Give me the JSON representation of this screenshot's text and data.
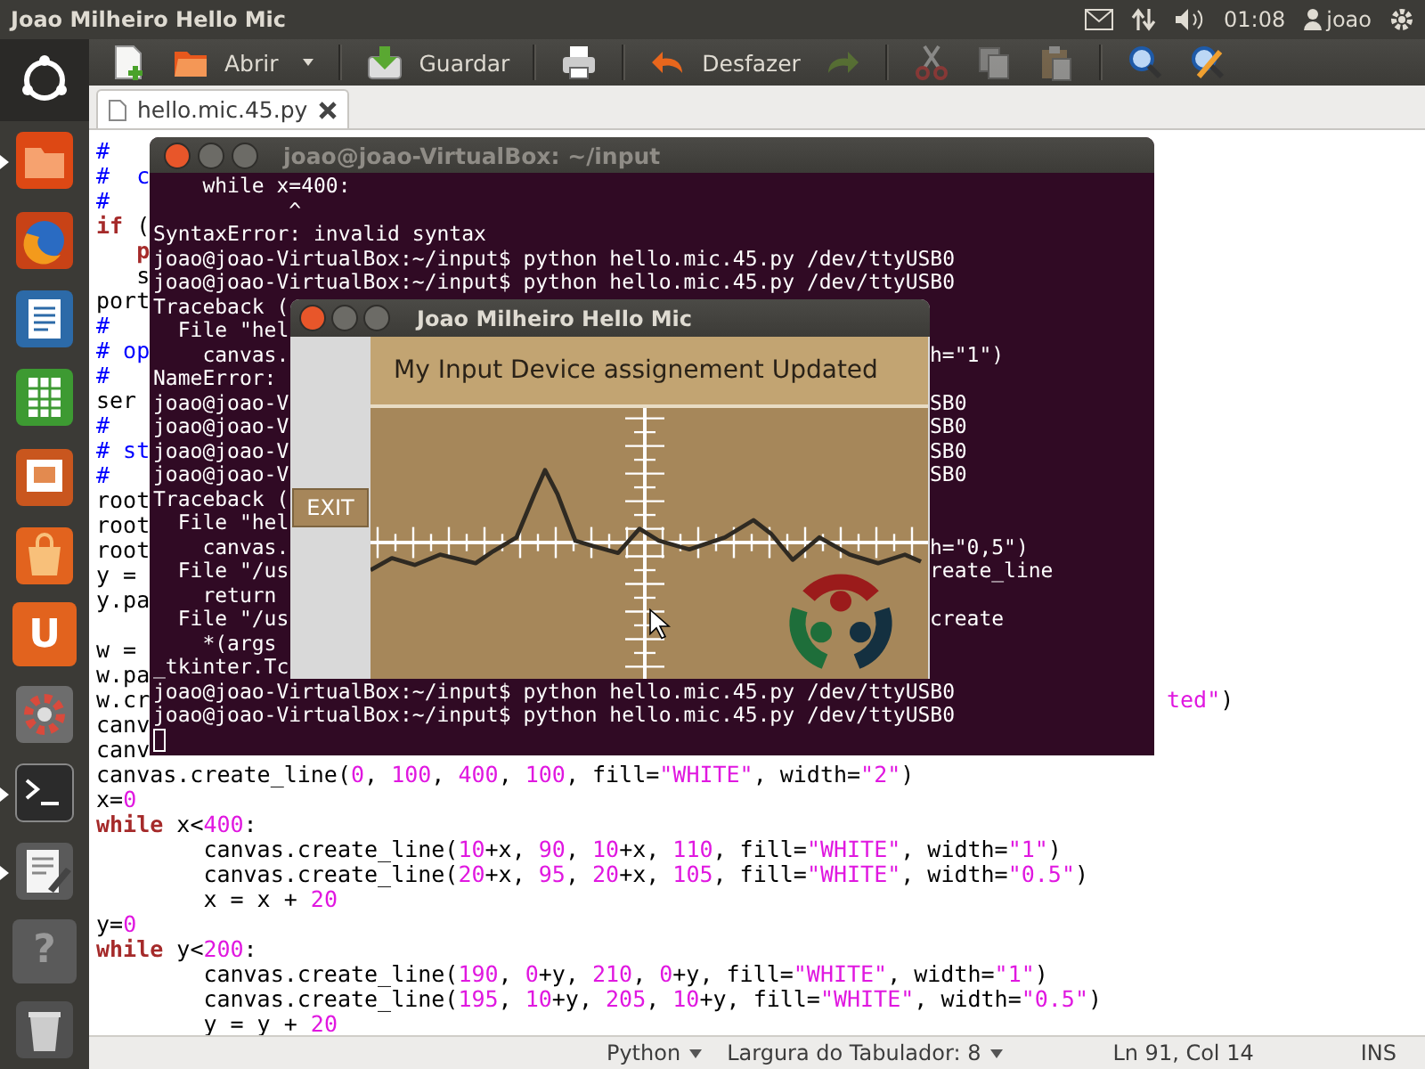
{
  "top_panel": {
    "title": "Joao Milheiro Hello Mic",
    "clock": "01:08",
    "user": "joao"
  },
  "launcher": [
    {
      "kind": "home",
      "running": false
    },
    {
      "kind": "files",
      "running": true
    },
    {
      "kind": "browser",
      "running": false
    },
    {
      "kind": "writer",
      "running": false
    },
    {
      "kind": "calc",
      "running": false
    },
    {
      "kind": "impress",
      "running": false
    },
    {
      "kind": "store",
      "running": false
    },
    {
      "kind": "ubuntu-one",
      "label": "U",
      "running": false
    },
    {
      "kind": "settings",
      "running": false
    },
    {
      "kind": "terminal",
      "running": true
    },
    {
      "kind": "editor",
      "running": true
    },
    {
      "kind": "help",
      "label": "?",
      "running": false
    },
    {
      "kind": "trash",
      "running": false
    }
  ],
  "toolbar": [
    {
      "kind": "new",
      "disabled": false
    },
    {
      "kind": "open",
      "label": "Abrir",
      "disabled": false
    },
    {
      "kind": "open-menu",
      "disabled": false
    },
    {
      "kind": "separator"
    },
    {
      "kind": "save",
      "label": "Guardar",
      "disabled": false
    },
    {
      "kind": "separator"
    },
    {
      "kind": "print",
      "disabled": false
    },
    {
      "kind": "separator"
    },
    {
      "kind": "undo",
      "label": "Desfazer",
      "disabled": false
    },
    {
      "kind": "redo",
      "disabled": true
    },
    {
      "kind": "separator"
    },
    {
      "kind": "cut",
      "disabled": true
    },
    {
      "kind": "copy",
      "disabled": true
    },
    {
      "kind": "paste",
      "disabled": true
    },
    {
      "kind": "separator"
    },
    {
      "kind": "find",
      "disabled": false
    },
    {
      "kind": "replace",
      "disabled": false
    }
  ],
  "tabs": [
    {
      "label": "hello.mic.45.py",
      "selected": true
    }
  ],
  "editor": {
    "lines": [
      {
        "kind": "code",
        "tokens": [
          {
            "kind": "comment",
            "text": "#"
          }
        ]
      },
      {
        "kind": "code",
        "tokens": [
          {
            "kind": "comment",
            "text": "#  c"
          }
        ]
      },
      {
        "kind": "code",
        "tokens": [
          {
            "kind": "comment",
            "text": "#"
          }
        ]
      },
      {
        "kind": "code",
        "tokens": [
          {
            "kind": "kw",
            "text": "if"
          },
          {
            "kind": "plain",
            "text": " ("
          }
        ]
      },
      {
        "kind": "code",
        "tokens": [
          {
            "kind": "kw",
            "text": "   p"
          }
        ]
      },
      {
        "kind": "code",
        "tokens": [
          {
            "kind": "plain",
            "text": "   s"
          }
        ]
      },
      {
        "kind": "code",
        "tokens": [
          {
            "kind": "plain",
            "text": "port"
          }
        ]
      },
      {
        "kind": "code",
        "tokens": [
          {
            "kind": "comment",
            "text": "#"
          }
        ]
      },
      {
        "kind": "code",
        "tokens": [
          {
            "kind": "comment",
            "text": "# op"
          }
        ]
      },
      {
        "kind": "code",
        "tokens": [
          {
            "kind": "comment",
            "text": "#"
          }
        ]
      },
      {
        "kind": "code",
        "tokens": [
          {
            "kind": "plain",
            "text": "ser"
          }
        ]
      },
      {
        "kind": "code",
        "tokens": [
          {
            "kind": "comment",
            "text": "#"
          }
        ]
      },
      {
        "kind": "code",
        "tokens": [
          {
            "kind": "comment",
            "text": "# st"
          }
        ]
      },
      {
        "kind": "code",
        "tokens": [
          {
            "kind": "comment",
            "text": "#"
          }
        ]
      },
      {
        "kind": "code",
        "tokens": [
          {
            "kind": "plain",
            "text": "root"
          }
        ]
      },
      {
        "kind": "code",
        "tokens": [
          {
            "kind": "plain",
            "text": "root"
          }
        ]
      },
      {
        "kind": "code",
        "tokens": [
          {
            "kind": "plain",
            "text": "root"
          }
        ]
      },
      {
        "kind": "code",
        "tokens": [
          {
            "kind": "plain",
            "text": "y ="
          }
        ]
      },
      {
        "kind": "code",
        "tokens": [
          {
            "kind": "plain",
            "text": "y.pa"
          }
        ]
      },
      {
        "kind": "blank"
      },
      {
        "kind": "code",
        "tokens": [
          {
            "kind": "plain",
            "text": "w ="
          }
        ]
      },
      {
        "kind": "code",
        "tokens": [
          {
            "kind": "plain",
            "text": "w.pa"
          }
        ]
      },
      {
        "kind": "code",
        "tokens": [
          {
            "kind": "plain",
            "text": "w.cr"
          }
        ],
        "right_tokens": [
          {
            "kind": "str",
            "text": "ted\""
          },
          {
            "kind": "plain",
            "text": ")"
          }
        ]
      },
      {
        "kind": "code",
        "tokens": [
          {
            "kind": "plain",
            "text": "canv"
          }
        ]
      },
      {
        "kind": "code",
        "tokens": [
          {
            "kind": "plain",
            "text": "canv"
          }
        ]
      },
      {
        "kind": "code",
        "tokens": [
          {
            "kind": "plain",
            "text": "canvas.create_line("
          },
          {
            "kind": "num",
            "text": "0"
          },
          {
            "kind": "plain",
            "text": ", "
          },
          {
            "kind": "num",
            "text": "100"
          },
          {
            "kind": "plain",
            "text": ", "
          },
          {
            "kind": "num",
            "text": "400"
          },
          {
            "kind": "plain",
            "text": ", "
          },
          {
            "kind": "num",
            "text": "100"
          },
          {
            "kind": "plain",
            "text": ", fill="
          },
          {
            "kind": "str",
            "text": "\"WHITE\""
          },
          {
            "kind": "plain",
            "text": ", width="
          },
          {
            "kind": "str",
            "text": "\"2\""
          },
          {
            "kind": "plain",
            "text": ")"
          }
        ]
      },
      {
        "kind": "code",
        "tokens": [
          {
            "kind": "plain",
            "text": "x="
          },
          {
            "kind": "num",
            "text": "0"
          }
        ]
      },
      {
        "kind": "code",
        "tokens": [
          {
            "kind": "kw",
            "text": "while"
          },
          {
            "kind": "plain",
            "text": " x<"
          },
          {
            "kind": "num",
            "text": "400"
          },
          {
            "kind": "plain",
            "text": ":"
          }
        ]
      },
      {
        "kind": "code",
        "tokens": [
          {
            "kind": "plain",
            "text": "        canvas.create_line("
          },
          {
            "kind": "num",
            "text": "10"
          },
          {
            "kind": "plain",
            "text": "+x, "
          },
          {
            "kind": "num",
            "text": "90"
          },
          {
            "kind": "plain",
            "text": ", "
          },
          {
            "kind": "num",
            "text": "10"
          },
          {
            "kind": "plain",
            "text": "+x, "
          },
          {
            "kind": "num",
            "text": "110"
          },
          {
            "kind": "plain",
            "text": ", fill="
          },
          {
            "kind": "str",
            "text": "\"WHITE\""
          },
          {
            "kind": "plain",
            "text": ", width="
          },
          {
            "kind": "str",
            "text": "\"1\""
          },
          {
            "kind": "plain",
            "text": ")"
          }
        ]
      },
      {
        "kind": "code",
        "tokens": [
          {
            "kind": "plain",
            "text": "        canvas.create_line("
          },
          {
            "kind": "num",
            "text": "20"
          },
          {
            "kind": "plain",
            "text": "+x, "
          },
          {
            "kind": "num",
            "text": "95"
          },
          {
            "kind": "plain",
            "text": ", "
          },
          {
            "kind": "num",
            "text": "20"
          },
          {
            "kind": "plain",
            "text": "+x, "
          },
          {
            "kind": "num",
            "text": "105"
          },
          {
            "kind": "plain",
            "text": ", fill="
          },
          {
            "kind": "str",
            "text": "\"WHITE\""
          },
          {
            "kind": "plain",
            "text": ", width="
          },
          {
            "kind": "str",
            "text": "\"0.5\""
          },
          {
            "kind": "plain",
            "text": ")"
          }
        ]
      },
      {
        "kind": "code",
        "tokens": [
          {
            "kind": "plain",
            "text": "        x = x + "
          },
          {
            "kind": "num",
            "text": "20"
          }
        ]
      },
      {
        "kind": "code",
        "tokens": [
          {
            "kind": "plain",
            "text": "y="
          },
          {
            "kind": "num",
            "text": "0"
          }
        ]
      },
      {
        "kind": "code",
        "tokens": [
          {
            "kind": "kw",
            "text": "while"
          },
          {
            "kind": "plain",
            "text": " y<"
          },
          {
            "kind": "num",
            "text": "200"
          },
          {
            "kind": "plain",
            "text": ":"
          }
        ]
      },
      {
        "kind": "code",
        "tokens": [
          {
            "kind": "plain",
            "text": "        canvas.create_line("
          },
          {
            "kind": "num",
            "text": "190"
          },
          {
            "kind": "plain",
            "text": ", "
          },
          {
            "kind": "num",
            "text": "0"
          },
          {
            "kind": "plain",
            "text": "+y, "
          },
          {
            "kind": "num",
            "text": "210"
          },
          {
            "kind": "plain",
            "text": ", "
          },
          {
            "kind": "num",
            "text": "0"
          },
          {
            "kind": "plain",
            "text": "+y, fill="
          },
          {
            "kind": "str",
            "text": "\"WHITE\""
          },
          {
            "kind": "plain",
            "text": ", width="
          },
          {
            "kind": "str",
            "text": "\"1\""
          },
          {
            "kind": "plain",
            "text": ")"
          }
        ]
      },
      {
        "kind": "code",
        "tokens": [
          {
            "kind": "plain",
            "text": "        canvas.create_line("
          },
          {
            "kind": "num",
            "text": "195"
          },
          {
            "kind": "plain",
            "text": ", "
          },
          {
            "kind": "num",
            "text": "10"
          },
          {
            "kind": "plain",
            "text": "+y, "
          },
          {
            "kind": "num",
            "text": "205"
          },
          {
            "kind": "plain",
            "text": ", "
          },
          {
            "kind": "num",
            "text": "10"
          },
          {
            "kind": "plain",
            "text": "+y, fill="
          },
          {
            "kind": "str",
            "text": "\"WHITE\""
          },
          {
            "kind": "plain",
            "text": ", width="
          },
          {
            "kind": "str",
            "text": "\"0.5\""
          },
          {
            "kind": "plain",
            "text": ")"
          }
        ]
      },
      {
        "kind": "code",
        "tokens": [
          {
            "kind": "plain",
            "text": "        y = y + "
          },
          {
            "kind": "num",
            "text": "20"
          }
        ]
      }
    ]
  },
  "terminal": {
    "title": "joao@joao-VirtualBox: ~/input",
    "cursor": true,
    "lines": [
      {
        "text": "    while x=400:"
      },
      {
        "text": "           ^"
      },
      {
        "text": "SyntaxError: invalid syntax"
      },
      {
        "text": "joao@joao-VirtualBox:~/input$ python hello.mic.45.py /dev/ttyUSB0"
      },
      {
        "text": "joao@joao-VirtualBox:~/input$ python hello.mic.45.py /dev/ttyUSB0"
      },
      {
        "text": "Traceback ("
      },
      {
        "text": "  File \"hel"
      },
      {
        "text": "    canvas.",
        "right": "h=\"1\")"
      },
      {
        "text": "NameError:"
      },
      {
        "text": "joao@joao-V",
        "right": "SB0"
      },
      {
        "text": "joao@joao-V",
        "right": "SB0"
      },
      {
        "text": "joao@joao-V",
        "right": "SB0"
      },
      {
        "text": "joao@joao-V",
        "right": "SB0"
      },
      {
        "text": "Traceback ("
      },
      {
        "text": "  File \"hel"
      },
      {
        "text": "    canvas.",
        "right": "h=\"0,5\")"
      },
      {
        "text": "  File \"/us",
        "right": "reate_line"
      },
      {
        "text": "    return"
      },
      {
        "text": "  File \"/us",
        "right": "create"
      },
      {
        "text": "    *(args"
      },
      {
        "text": "_tkinter.Tc"
      },
      {
        "text": "joao@joao-VirtualBox:~/input$ python hello.mic.45.py /dev/ttyUSB0"
      },
      {
        "text": "joao@joao-VirtualBox:~/input$ python hello.mic.45.py /dev/ttyUSB0"
      }
    ]
  },
  "tk_window": {
    "title": "Joao Milheiro Hello Mic",
    "exit_button": "EXIT",
    "heading": "My Input Device assignement Updated"
  },
  "status_bar": {
    "language": "Python",
    "tab_width": "Largura do Tabulador: 8",
    "position": "Ln 91, Col 14",
    "mode": "INS"
  }
}
